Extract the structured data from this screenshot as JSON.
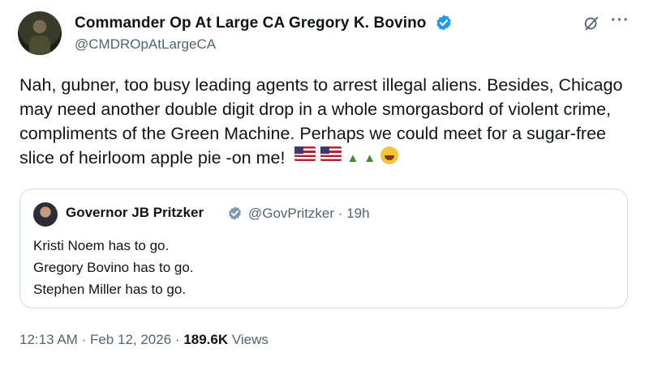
{
  "post": {
    "author_name": "Commander Op At Large CA Gregory K. Bovino",
    "author_handle": "@CMDROpAtLargeCA",
    "text": "Nah, gubner, too busy leading agents to arrest illegal aliens.  Besides, Chicago may need another double digit drop in a whole smorgasbord of violent crime, compliments of the Green Machine.  Perhaps we could meet for a sugar-free slice of heirloom apple pie -on me!",
    "emojis": [
      "us-flag",
      "us-flag",
      "crocodile",
      "crocodile",
      "laughing-face"
    ],
    "time": "12:13 AM",
    "date": "Feb 12, 2026",
    "views_count": "189.6K",
    "views_label": "Views",
    "separator": "·"
  },
  "quoted": {
    "author_name": "Governor JB Pritzker",
    "author_handle": "@GovPritzker · 19h",
    "lines": [
      "Kristi Noem has to go.",
      "Gregory Bovino has to go.",
      "Stephen Miller has to go."
    ]
  },
  "colors": {
    "verified": "#1d9bf0",
    "secondary_text": "#536471",
    "border": "#cfd9de"
  }
}
